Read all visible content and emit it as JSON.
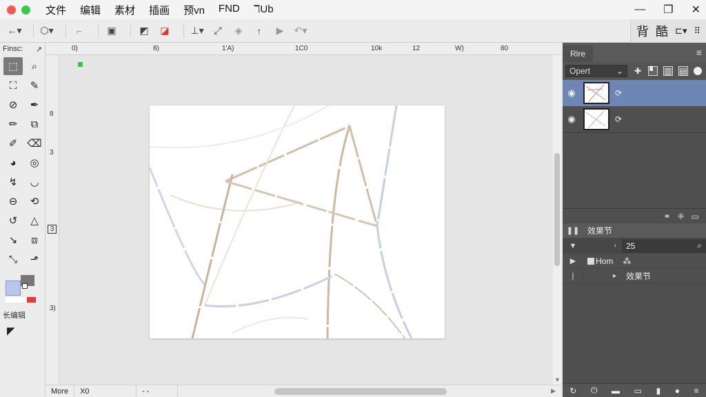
{
  "menu": {
    "items": [
      "文件",
      "编辑",
      "素材",
      "插画",
      "预vn",
      "FND",
      "ℸUb"
    ]
  },
  "window_controls": {
    "minimize": "—",
    "restore": "❐",
    "close": "✕"
  },
  "toolbar_right": {
    "label1": "背",
    "label2": "酷",
    "extra": "⊏▾"
  },
  "tools_panel": {
    "title": "Finsc:",
    "label": "长编辑"
  },
  "ruler_h": [
    "0)",
    "8)",
    "1'A)",
    "1C0",
    "10k",
    "12",
    "W)",
    "80"
  ],
  "ruler_v": [
    "8",
    "3",
    "3",
    "3)"
  ],
  "status": {
    "mode": "More",
    "value": "X0",
    "extra": "- -"
  },
  "right_panel": {
    "tab": "Rlre",
    "blend_mode": "Opert",
    "props_title": "效果节",
    "props_rows": [
      {
        "c2": "›",
        "c3": "25"
      },
      {
        "c2": "",
        "c3": "Hom",
        "tag": "⁂"
      },
      {
        "c2": "▸",
        "c3": "效果节"
      }
    ]
  },
  "colors": {
    "layer_selected": "#6d86b3",
    "panel_bg": "#4f4f4f",
    "swatch_fg": "#b7c7ee"
  }
}
